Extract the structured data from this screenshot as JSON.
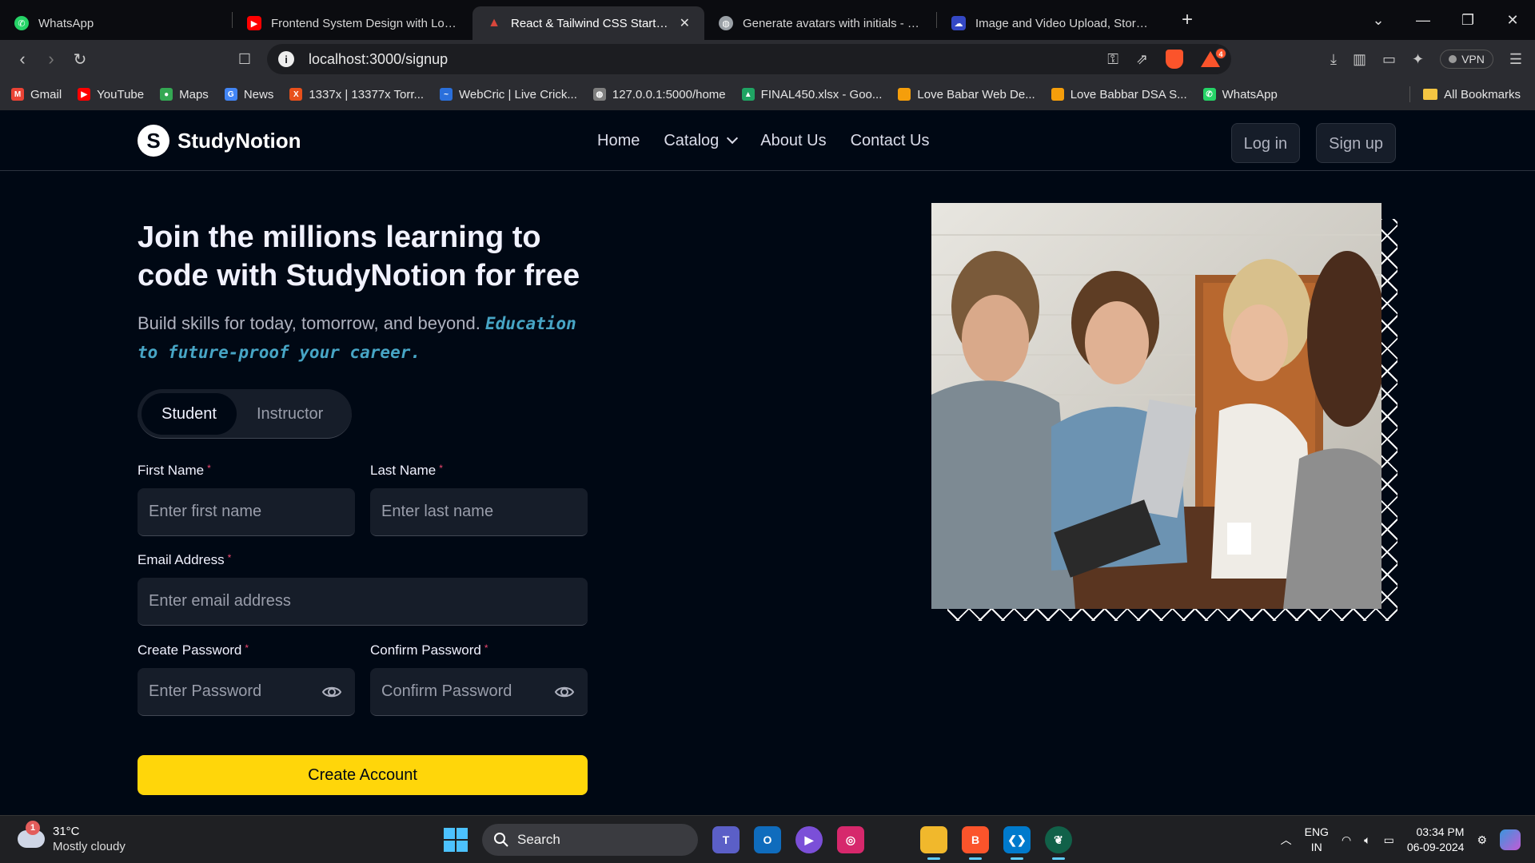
{
  "browser": {
    "tabs": [
      {
        "title": "WhatsApp",
        "active": false,
        "favicon_color": "#25D366"
      },
      {
        "title": "Frontend System Design with Low L",
        "active": false,
        "favicon_color": "#FF0000"
      },
      {
        "title": "React & Tailwind CSS Starter Pa",
        "active": true,
        "favicon_color": "#D8463B"
      },
      {
        "title": "Generate avatars with initials - User",
        "active": false,
        "favicon_color": "#9aa0a6"
      },
      {
        "title": "Image and Video Upload, Storage, C",
        "active": false,
        "favicon_color": "#3448C5"
      }
    ],
    "url": "localhost:3000/signup",
    "vpn_label": "VPN",
    "brave_badge": "4",
    "bookmarks": [
      {
        "label": "Gmail",
        "color": "#EA4335",
        "glyph": "M"
      },
      {
        "label": "YouTube",
        "color": "#FF0000",
        "glyph": "▶"
      },
      {
        "label": "Maps",
        "color": "#34A853",
        "glyph": "●"
      },
      {
        "label": "News",
        "color": "#4285F4",
        "glyph": "G"
      },
      {
        "label": "1337x | 13377x Torr...",
        "color": "#E8501B",
        "glyph": "X"
      },
      {
        "label": "WebCric | Live Crick...",
        "color": "#2A6FDB",
        "glyph": "~"
      },
      {
        "label": "127.0.0.1:5000/home",
        "color": "#7f7f7f",
        "glyph": "◍"
      },
      {
        "label": "FINAL450.xlsx - Goo...",
        "color": "#1FA463",
        "glyph": "▲"
      },
      {
        "label": "Love Babar Web De...",
        "color": "#F59E0B",
        "glyph": ""
      },
      {
        "label": "Love Babbar DSA S...",
        "color": "#F59E0B",
        "glyph": ""
      },
      {
        "label": "WhatsApp",
        "color": "#25D366",
        "glyph": "✆"
      }
    ],
    "all_bookmarks": "All Bookmarks"
  },
  "site": {
    "brand": "StudyNotion",
    "brand_mark": "S",
    "menu": {
      "home": "Home",
      "catalog": "Catalog",
      "about": "About Us",
      "contact": "Contact Us"
    },
    "login": "Log in",
    "signup": "Sign up"
  },
  "signup": {
    "heading": "Join the millions learning to code with StudyNotion for free",
    "sub_plain": "Build skills for today, tomorrow, and beyond.",
    "sub_highlight": "Education to future-proof your career.",
    "roles": [
      "Student",
      "Instructor"
    ],
    "selected_role": "Student",
    "first_name": {
      "label": "First Name",
      "placeholder": "Enter first name"
    },
    "last_name": {
      "label": "Last Name",
      "placeholder": "Enter last name"
    },
    "email": {
      "label": "Email Address",
      "placeholder": "Enter email address"
    },
    "password": {
      "label": "Create Password",
      "placeholder": "Enter Password"
    },
    "confirm": {
      "label": "Confirm Password",
      "placeholder": "Confirm Password"
    },
    "required_mark": "*",
    "submit": "Create Account"
  },
  "taskbar": {
    "weather_temp": "31°C",
    "weather_desc": "Mostly cloudy",
    "weather_badge": "1",
    "search": "Search",
    "lang_line1": "ENG",
    "lang_line2": "IN",
    "time": "03:34 PM",
    "date": "06-09-2024"
  },
  "colors": {
    "background": "#000814",
    "accent_yellow": "#FFD60A",
    "highlight_blue": "#47A5C5",
    "required_pink": "#EF476F"
  }
}
